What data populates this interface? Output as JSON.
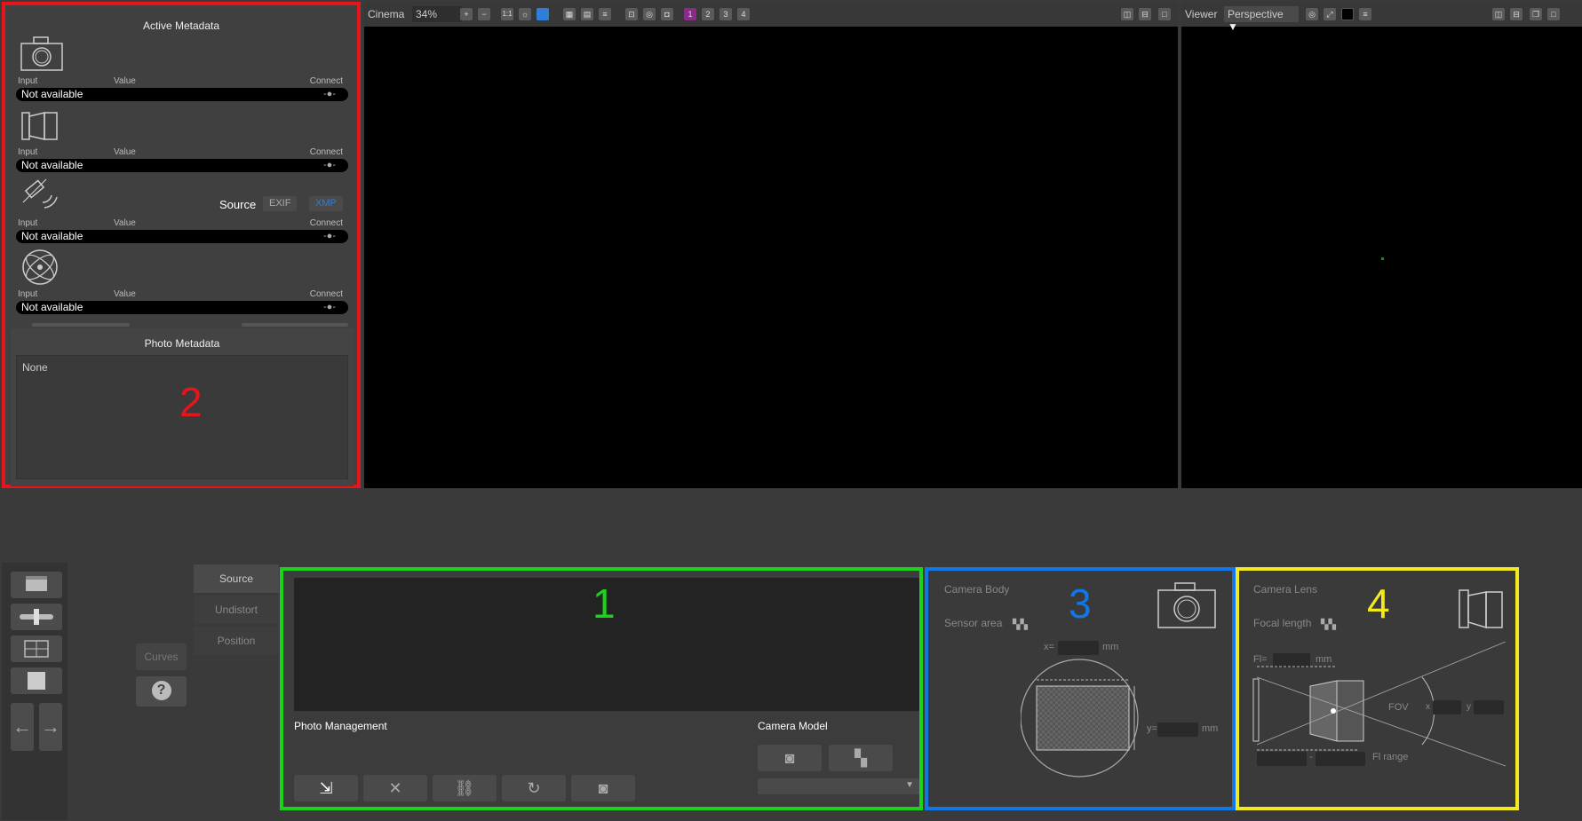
{
  "active_metadata": {
    "title": "Active Metadata",
    "col_input": "Input",
    "col_value": "Value",
    "col_connect": "Connect",
    "rows": [
      {
        "value": "Not available",
        "icon": "camera-body-icon"
      },
      {
        "value": "Not available",
        "icon": "camera-lens-icon"
      },
      {
        "value": "Not available",
        "icon": "gps-satellite-icon"
      },
      {
        "value": "Not available",
        "icon": "gyroscope-icon"
      }
    ],
    "source_label": "Source",
    "source_exif": "EXIF",
    "source_xmp": "XMP"
  },
  "photo_metadata": {
    "title": "Photo Metadata",
    "value": "None"
  },
  "cinema_view": {
    "label": "Cinema",
    "zoom": "34%",
    "one_to_one": "1:1",
    "pages": [
      "1",
      "2",
      "3",
      "4"
    ]
  },
  "viewer": {
    "label": "Viewer",
    "mode": "Perspective"
  },
  "tabs": {
    "source": "Source",
    "undistort": "Undistort",
    "position": "Position"
  },
  "side": {
    "curves": "Curves",
    "help": "?"
  },
  "photo_management": {
    "title": "Photo Management",
    "camera_model": "Camera Model"
  },
  "camera_body": {
    "title": "Camera Body",
    "sensor_area": "Sensor area",
    "x_label": "x=",
    "y_label": "y=",
    "unit": "mm"
  },
  "camera_lens": {
    "title": "Camera Lens",
    "focal_length": "Focal length",
    "fl_label": "Fl=",
    "unit": "mm",
    "fov": "FOV",
    "x_label": "x",
    "y_label": "y",
    "fl_range": "Fl range",
    "dash": "-"
  },
  "annotations": {
    "one": "1",
    "two": "2",
    "three": "3",
    "four": "4"
  },
  "colors": {
    "red": "#e8141b",
    "green": "#1bd31b",
    "blue": "#1177e8",
    "yellow": "#f2ea1e"
  }
}
